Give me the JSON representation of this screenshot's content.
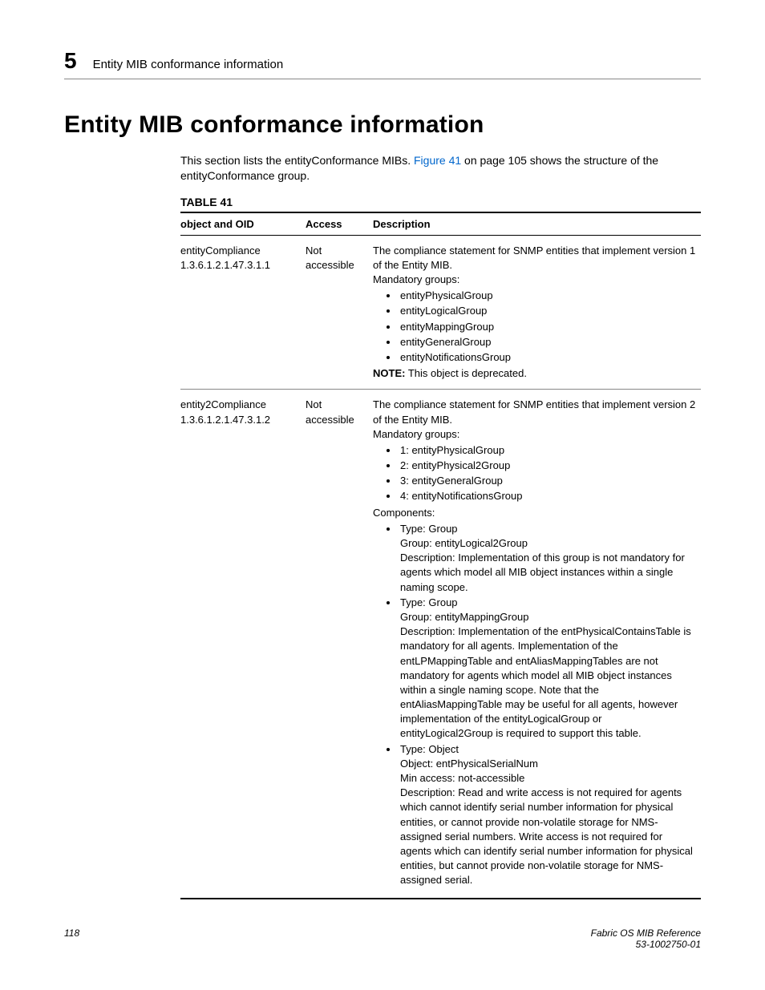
{
  "header": {
    "chapter_number": "5",
    "running_head": "Entity MIB conformance information"
  },
  "title": "Entity MIB conformance information",
  "intro": {
    "part1": "This section lists the entityConformance MIBs. ",
    "link": "Figure 41",
    "part2": " on page 105 shows the structure of the entityConformance group."
  },
  "table": {
    "caption": "TABLE 41",
    "headers": {
      "col1": "object and OID",
      "col2": "Access",
      "col3": "Description"
    },
    "rows": [
      {
        "object_name": "entityCompliance",
        "oid": "1.3.6.1.2.1.47.3.1.1",
        "access": "Not accessible",
        "desc_intro": "The compliance statement for SNMP entities that implement version 1 of the Entity MIB.",
        "mandatory_label": "Mandatory groups:",
        "mandatory_groups": [
          "entityPhysicalGroup",
          "entityLogicalGroup",
          "entityMappingGroup",
          "entityGeneralGroup",
          "entityNotificationsGroup"
        ],
        "note_label": "NOTE:",
        "note_text": "  This object is deprecated."
      },
      {
        "object_name": "entity2Compliance",
        "oid": "1.3.6.1.2.1.47.3.1.2",
        "access": "Not accessible",
        "desc_intro": "The compliance statement for SNMP entities that implement version 2 of the Entity MIB.",
        "mandatory_label": "Mandatory groups:",
        "mandatory_groups": [
          "1: entityPhysicalGroup",
          "2: entityPhysical2Group",
          "3: entityGeneralGroup",
          "4: entityNotificationsGroup"
        ],
        "components_label": "Components:",
        "components": [
          {
            "heading": "Type: Group",
            "lines": [
              "Group: entityLogical2Group",
              "Description: Implementation of this group is not mandatory for agents which model all MIB object instances within a single naming scope."
            ]
          },
          {
            "heading": "Type: Group",
            "lines": [
              "Group: entityMappingGroup",
              "Description: Implementation of the entPhysicalContainsTable is mandatory for all agents. Implementation of the entLPMappingTable and entAliasMappingTables are not mandatory for agents which model all MIB object instances within a single naming scope. Note that the entAliasMappingTable may be useful for all agents, however implementation of the entityLogicalGroup or entityLogical2Group is required to support this table."
            ]
          },
          {
            "heading": "Type: Object",
            "lines": [
              "Object: entPhysicalSerialNum",
              "Min access: not-accessible",
              "Description: Read and write access is not required for agents which cannot identify serial number information for physical entities, or cannot provide non-volatile storage for NMS-assigned serial numbers. Write access is not required for agents which can identify serial number information for physical entities, but cannot provide non-volatile storage for NMS-assigned serial."
            ]
          }
        ]
      }
    ]
  },
  "footer": {
    "page_number": "118",
    "doc_title": "Fabric OS MIB Reference",
    "doc_id": "53-1002750-01"
  }
}
